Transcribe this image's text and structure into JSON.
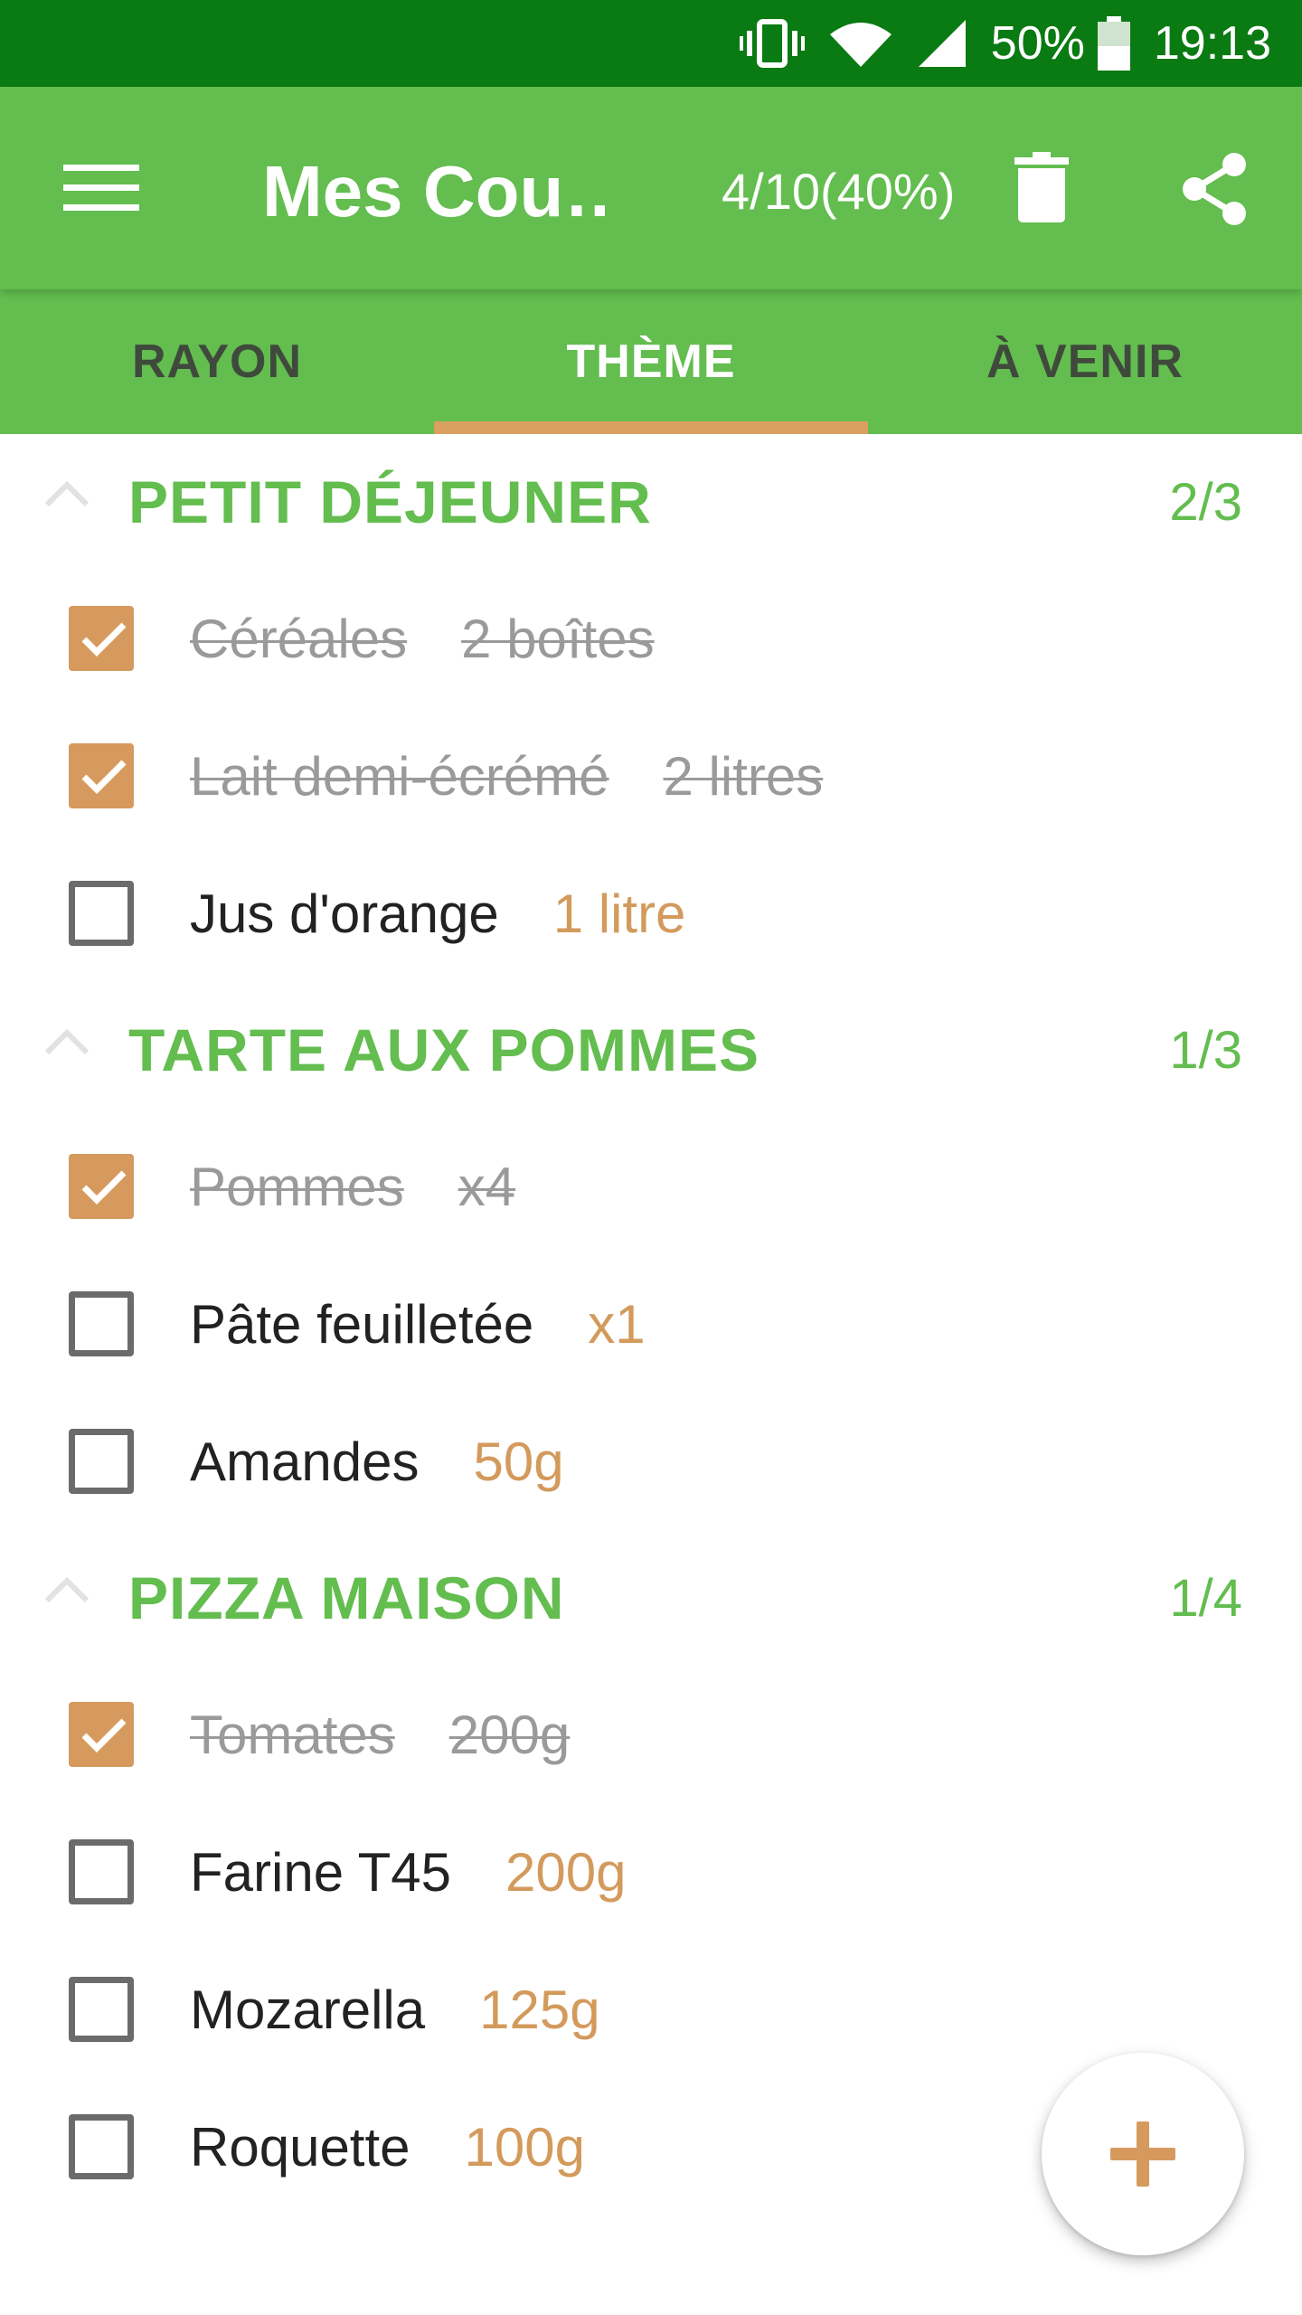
{
  "status_bar": {
    "battery_percent": "50%",
    "time": "19:13",
    "icons": [
      "vibrate-icon",
      "wifi-icon",
      "signal-icon",
      "battery-icon"
    ]
  },
  "app_bar": {
    "title": "Mes Cou…",
    "progress": "4/10(40%)",
    "icons": [
      "menu-icon",
      "trash-icon",
      "share-icon"
    ]
  },
  "tabs": [
    {
      "label": "RAYON",
      "active": false
    },
    {
      "label": "THÈME",
      "active": true
    },
    {
      "label": "À VENIR",
      "active": false
    }
  ],
  "sections": [
    {
      "title": "PETIT DÉJEUNER",
      "count": "2/3",
      "items": [
        {
          "name": "Céréales",
          "qty": "2 boîtes",
          "checked": true
        },
        {
          "name": "Lait demi-écrémé",
          "qty": "2 litres",
          "checked": true
        },
        {
          "name": "Jus d'orange",
          "qty": "1 litre",
          "checked": false
        }
      ]
    },
    {
      "title": "TARTE AUX POMMES",
      "count": "1/3",
      "items": [
        {
          "name": "Pommes",
          "qty": "x4",
          "checked": true
        },
        {
          "name": "Pâte feuilletée",
          "qty": "x1",
          "checked": false
        },
        {
          "name": "Amandes",
          "qty": "50g",
          "checked": false
        }
      ]
    },
    {
      "title": "PIZZA MAISON",
      "count": "1/4",
      "items": [
        {
          "name": "Tomates",
          "qty": "200g",
          "checked": true
        },
        {
          "name": "Farine T45",
          "qty": "200g",
          "checked": false
        },
        {
          "name": "Mozarella",
          "qty": "125g",
          "checked": false
        },
        {
          "name": "Roquette",
          "qty": "100g",
          "checked": false
        }
      ]
    }
  ],
  "fab": {
    "icon": "plus-icon"
  },
  "colors": {
    "status_bar": "#0a7a12",
    "primary": "#63bd4f",
    "accent": "#d69a5e",
    "done_text": "#9a9a9a"
  }
}
